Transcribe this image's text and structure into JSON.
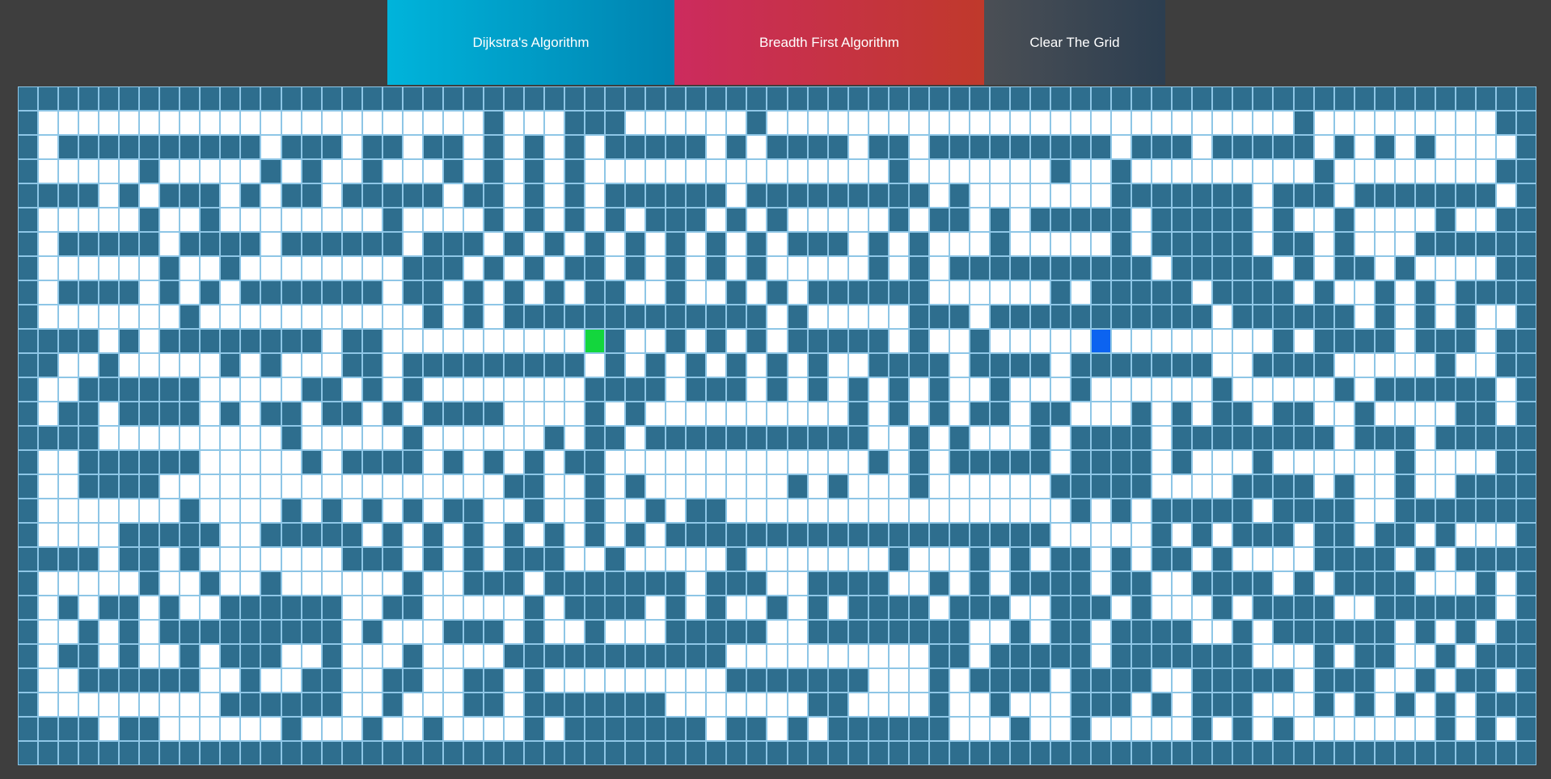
{
  "toolbar": {
    "dijkstra_label": "Dijkstra's Algorithm",
    "bfs_label": "Breadth First Algorithm",
    "clear_label": "Clear The Grid"
  },
  "grid": {
    "rows": 28,
    "cols": 75,
    "legend": {
      "#": "wall",
      ".": "empty",
      "S": "start",
      "E": "end"
    },
    "cells": [
      "###########################################################################",
      "#......................#...###......#..........................#.........#.",
      "#.##########.###.##.##.#.#.#.#####.#.####.##.#########.###.#####.#.#.#....#",
      "#.....#.....#.#..#...#.#.#.#...............#.......#..#.........#........#.",
      "####.#.###.#.##.#####.##.#.#.######.#########.#.......#######.###.#######.#",
      "#.....#..#........#....#.#.#.#.###.#.#.....#.##.#.#####.#####.#..#....#..#.",
      "#.#####.####.######.###.#.#.#.#.#.#.#.###.#.#...#.....#.#####.##.#...#####.",
      "#......#..#........###.#.#.##.#.#.#.#.....#.#.##########.#####.#.##.#....#.",
      "#.####.#.#.#######.##.#.#.#.##..#..#.#.######......#.#####.####.#..#.#.####",
      "#.......#...........#.#.#############.#.....###.###########.######.#.#.#..#",
      "####.#.########.##..........S#..#.#.#.#####.#..#.....E........#.####.###.##",
      "##..#.....#.#...##.#########.#.#.#.#.#.#..####.####.#######..####.....#..#.",
      "#..######.....##.#.#........####.###.#.#.#.#.#..#...#......#.....#.######.#",
      "#.##.####.#.##.##.#.####....#.#..........#.#.#.##.##...#.#.##.##..#....##.#",
      "####.........#.....#......#.##.###########..#.#...#.####.########.###.####.",
      "#..######.....#.####.#.#.#.##.............#.#.#####.####.#...#......#....#.",
      "#..####.................##..#.#.......#.#...#......#####....####.#..#..###.",
      "#.......#....#.#.#.#.##..#..#..#.##.................#.#.#####.####..######.",
      "#....#####..#####.#.#.#.#.#.#.#.###################.....#.#.###.##.##.#...#",
      "####.##.#.......###.#.#.###..#.....#.......#...#.#.##.#.##.#....####.#.###",
      "#.....#..#..#......#..###.#######.###..####..#.#.####.##..####.#.####...#.#",
      "#.#.##.#..######..##.....#.####.#.#..#.#.####.###..###.#...#.####..######..#",
      "#..#.#.#########.#...###.#..#...#####..########..#.##.####..#.######.#.#.#.#",
      "#.##.#..#.###..#...#....###########..........##.#####.#######...#.##..#.####",
      "#..######..#..##..##..##.#.........#######...#.####.####..#####.###..#.##..#",
      "#.........######..#...##.#######.......##....#..#...###.#.###...#.#.#.#.####",
      "####.##......#...#..#....#.#######.##.#.######...#..#.....#.#.#.......#.#.#",
      "#.#...#..###..#......#.....###.#...###...#.#.#...#......#..#.#.#.####.####.",
      "#........#.....#.....#.....................................#..............#"
    ]
  }
}
